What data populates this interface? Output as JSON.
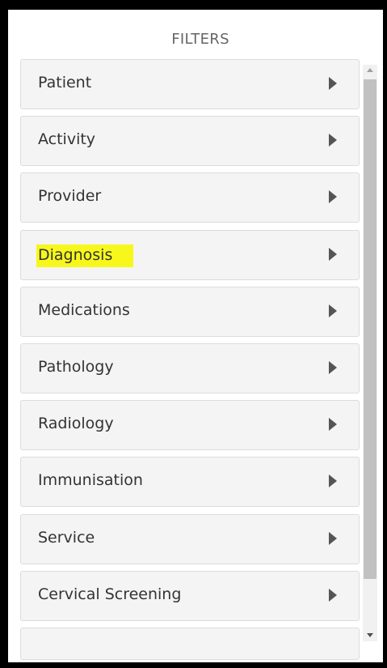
{
  "panel": {
    "title": "FILTERS"
  },
  "filters": [
    {
      "label": "Patient",
      "highlighted": false
    },
    {
      "label": "Activity",
      "highlighted": false
    },
    {
      "label": "Provider",
      "highlighted": false
    },
    {
      "label": "Diagnosis",
      "highlighted": true
    },
    {
      "label": "Medications",
      "highlighted": false
    },
    {
      "label": "Pathology",
      "highlighted": false
    },
    {
      "label": "Radiology",
      "highlighted": false
    },
    {
      "label": "Immunisation",
      "highlighted": false
    },
    {
      "label": "Service",
      "highlighted": false
    },
    {
      "label": "Cervical Screening",
      "highlighted": false
    }
  ],
  "colors": {
    "highlight": "#f7f71c",
    "item_background": "#f4f4f4",
    "chevron": "#555555",
    "frame_border": "#000000"
  },
  "icons": {
    "expand": "chevron-right-icon",
    "scroll_up": "scroll-up-arrow-icon",
    "scroll_down": "scroll-down-arrow-icon"
  }
}
